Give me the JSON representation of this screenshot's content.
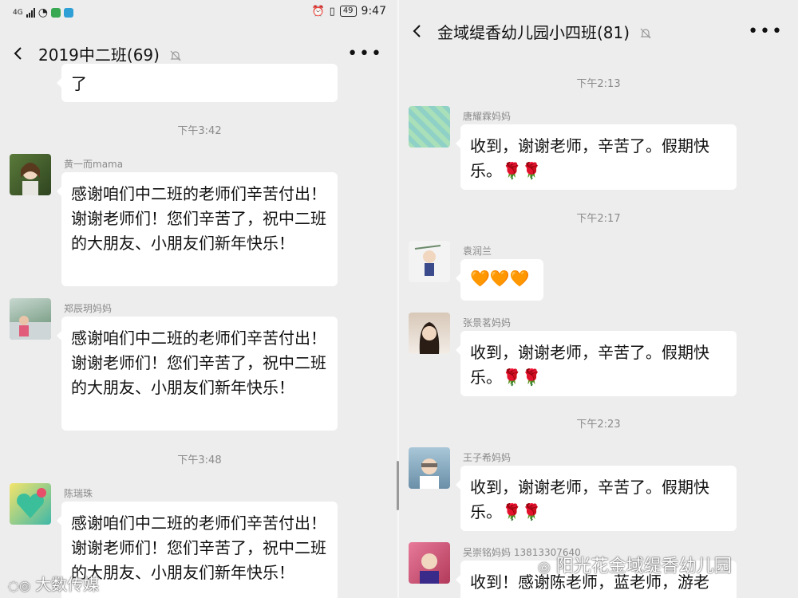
{
  "status": {
    "network": "4G",
    "battery": "49",
    "time": "9:47"
  },
  "left": {
    "title": "2019中二班(69)",
    "partial_bubble_text": "了",
    "time1": "下午3:42",
    "time2": "下午3:48",
    "messages": [
      {
        "sender": "黄一而mama",
        "text": "感谢咱们中二班的老师们辛苦付出！谢谢老师们！您们辛苦了，祝中二班的大朋友、小朋友们新年快乐！"
      },
      {
        "sender": "郑辰玥妈妈",
        "text": "感谢咱们中二班的老师们辛苦付出！谢谢老师们！您们辛苦了，祝中二班的大朋友、小朋友们新年快乐！"
      },
      {
        "sender": "陈瑞珠",
        "text": "感谢咱们中二班的老师们辛苦付出！谢谢老师们！您们辛苦了，祝中二班的大朋友、小朋友们新年快乐！"
      }
    ]
  },
  "right": {
    "title": "金域缇香幼儿园小四班(81)",
    "time1": "下午2:13",
    "time2": "下午2:17",
    "time3": "下午2:23",
    "messages": [
      {
        "sender": "唐耀霖妈妈",
        "text": "收到，谢谢老师，辛苦了。假期快乐。🌹🌹"
      },
      {
        "sender": "袁润兰",
        "text": "🧡🧡🧡"
      },
      {
        "sender": "张景茗妈妈",
        "text": "收到，谢谢老师，辛苦了。假期快乐。🌹🌹"
      },
      {
        "sender": "王子希妈妈",
        "text": "收到，谢谢老师，辛苦了。假期快乐。🌹🌹"
      },
      {
        "sender": "吴崇铭妈妈 13813307640",
        "text": "收到！感谢陈老师，蓝老师，游老"
      }
    ]
  },
  "watermarks": {
    "left": "大数传媒",
    "right": "阳光花金域缇香幼儿园"
  },
  "colors": {
    "background": "#ededed",
    "bubble": "#ffffff",
    "meta_text": "#8a8a8a"
  }
}
